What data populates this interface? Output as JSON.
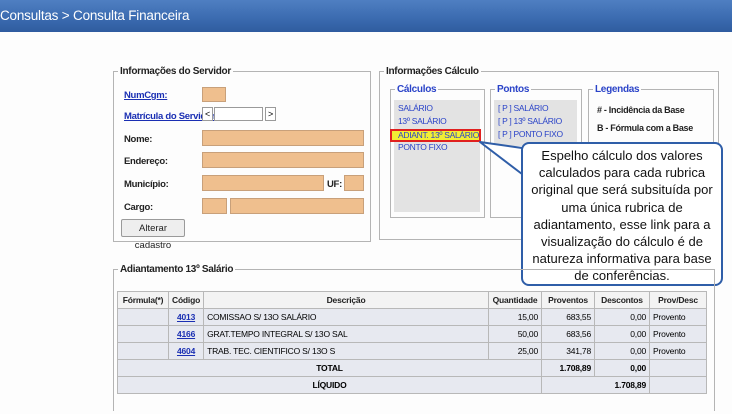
{
  "header": {
    "breadcrumb": "Consultas > Consulta Financeira"
  },
  "servidor": {
    "legend": "Informações do Servidor",
    "numcgm_label": "NumCgm:",
    "matricula_label": "Matrícula do Servidor:",
    "prev_btn": "<",
    "next_btn": ">",
    "nome_label": "Nome:",
    "endereco_label": "Endereço:",
    "municipio_label": "Município:",
    "uf_label": "UF:",
    "cargo_label": "Cargo:",
    "alterar_button": "Alterar cadastro"
  },
  "calculo": {
    "legend": "Informações Cálculo",
    "calculos": {
      "legend": "Cálculos",
      "items": [
        "SALÁRIO",
        "13º SALÁRIO",
        "ADIANT. 13º SALÁRIO",
        "PONTO FIXO"
      ]
    },
    "pontos": {
      "legend": "Pontos",
      "items": [
        "[ P ] SALÁRIO",
        "[ P ] 13º SALÁRIO",
        "[ P ] PONTO FIXO"
      ]
    },
    "legendas": {
      "legend": "Legendas",
      "items": [
        "# - Incidência da Base",
        "B - Fórmula com a Base"
      ]
    }
  },
  "callout": {
    "text": "Espelho cálculo dos valores calculados para cada rubrica original que será subsituída por uma única rubrica de adiantamento, esse link para a visualização do cálculo é de natureza informativa para base de conferências."
  },
  "adiantamento": {
    "legend": "Adiantamento 13º Salário",
    "headers": [
      "Fórmula(*)",
      "Código",
      "Descrição",
      "Quantidade",
      "Proventos",
      "Descontos",
      "Prov/Desc"
    ],
    "rows": [
      {
        "formula": "",
        "codigo": "4013",
        "descricao": "COMISSAO S/ 13O SALÁRIO",
        "quantidade": "15,00",
        "proventos": "683,55",
        "descontos": "0,00",
        "tipo": "Provento"
      },
      {
        "formula": "",
        "codigo": "4166",
        "descricao": "GRAT.TEMPO INTEGRAL S/ 13O SAL",
        "quantidade": "50,00",
        "proventos": "683,56",
        "descontos": "0,00",
        "tipo": "Provento"
      },
      {
        "formula": "",
        "codigo": "4604",
        "descricao": "TRAB. TEC. CIENTIFICO S/ 13O S",
        "quantidade": "25,00",
        "proventos": "341,78",
        "descontos": "0,00",
        "tipo": "Provento"
      }
    ],
    "total_label": "TOTAL",
    "total_proventos": "1.708,89",
    "total_descontos": "0,00",
    "liquido_label": "LÍQUIDO",
    "liquido_valor": "1.708,89"
  },
  "colors": {
    "titlebar": "#3a6aaf",
    "input_tan": "#efbf8e",
    "highlight_border": "#e0201f",
    "highlight_fill": "#f2ee34",
    "callout_border": "#2f5ea8"
  }
}
